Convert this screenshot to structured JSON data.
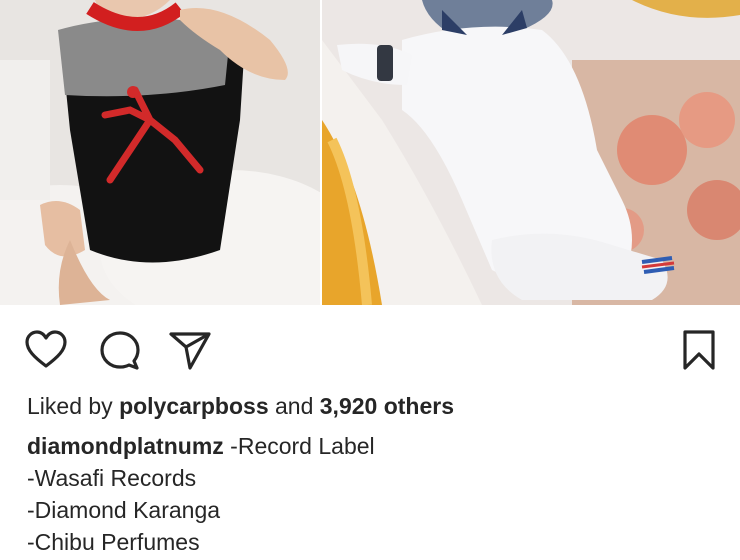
{
  "post": {
    "images": [
      {
        "name": "photo-left",
        "alt": ""
      },
      {
        "name": "photo-right",
        "alt": ""
      }
    ]
  },
  "icons": {
    "like": "heart-icon",
    "comment": "comment-bubble-icon",
    "share": "paper-plane-icon",
    "save": "bookmark-icon"
  },
  "likes": {
    "prefix": "Liked by",
    "user": "polycarpboss",
    "conjunction": "and",
    "others": "3,920 others"
  },
  "caption": {
    "username": "diamondplatnumz",
    "first_line": "-Record Label",
    "lines": [
      "-Wasafi Records",
      "-Diamond Karanga",
      "-Chibu Perfumes"
    ]
  },
  "colors": {
    "text": "#262626",
    "background": "#ffffff"
  }
}
